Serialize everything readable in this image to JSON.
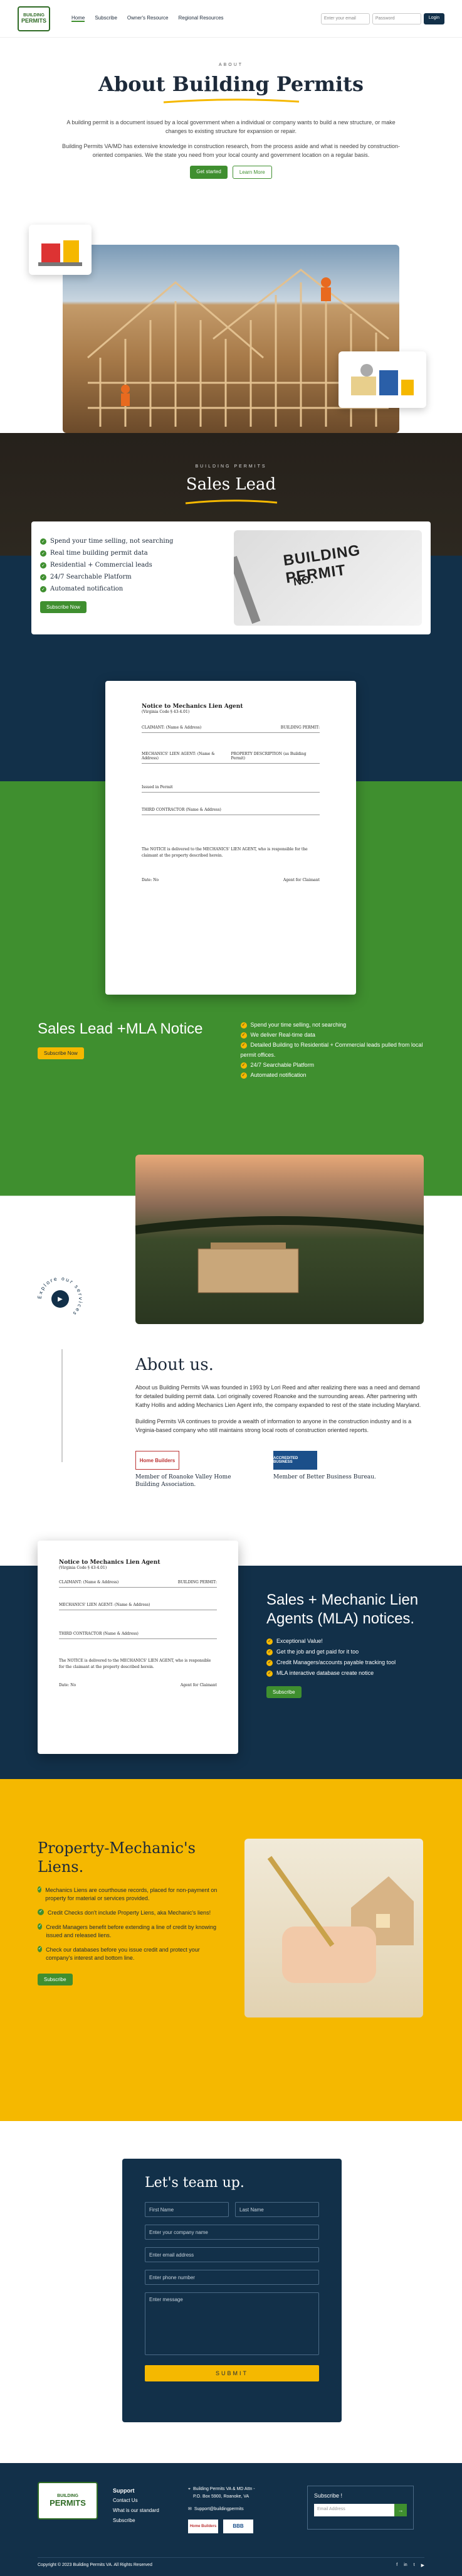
{
  "header": {
    "logo_line1": "BUILDING",
    "logo_line2": "PERMITS",
    "nav": [
      "Home",
      "Subscribe",
      "Owner's Resource",
      "Regional Resources"
    ],
    "search_placeholder": "Enter your email",
    "search_field2": "Password",
    "login_label": "Login"
  },
  "about_permits": {
    "eyebrow": "ABOUT",
    "title": "About Building Permits",
    "p1": "A building permit is a document issued by a local government when a individual or company wants to build a new structure, or make changes to existing structure for expansion or repair.",
    "p2": "Building Permits VA/MD has extensive knowledge in construction research, from the process aside and what is needed by construction-oriented companies. We the state you need from your local county and government location on a regular basis.",
    "btn1": "Get started",
    "btn2": "Learn More"
  },
  "sales_lead": {
    "eyebrow": "BUILDING PERMITS",
    "title": "Sales Lead",
    "items": [
      "Spend your time selling, not searching",
      "Real time building permit data",
      "Residential + Commercial leads",
      "24/7 Searchable Platform",
      "Automated notification"
    ],
    "btn": "Subscribe Now",
    "image_text": "BUILDING PERMIT",
    "image_no": "NO."
  },
  "document": {
    "title": "Notice to Mechanics Lien Agent",
    "subtitle": "(Virginia Code § 43-4.01)",
    "l1": "CLAIMANT: (Name & Address)",
    "l2": "BUILDING PERMIT:",
    "l3": "MECHANICS' LIEN AGENT: (Name & Address)",
    "l4": "PROPERTY DESCRIPTION (as Building Permit)",
    "l5": "Issued in Permit",
    "l6": "THIRD CONTRACTOR (Name & Address)",
    "l7": "The NOTICE is delivered to the MECHANICS' LIEN AGENT, who is responsible for the claimant at the property described herein.",
    "date": "Date: No",
    "sign": "Agent for Claimant"
  },
  "mla": {
    "title": "Sales Lead +MLA Notice",
    "btn": "Subscribe Now",
    "items": [
      "Spend your time selling, not searching",
      "We deliver Real-time data",
      "Detailed Building to Residential + Commercial leads pulled from local permit offices.",
      "24/7 Searchable Platform",
      "Automated notification"
    ]
  },
  "about_us": {
    "explore": "Explore our services",
    "title": "About us.",
    "p1": "About us Building Permits VA was founded in 1993 by Lori Reed and after realizing there was a need and demand for detailed building permit data. Lori originally covered Roanoke and the surrounding areas. After partnering with Kathy Hollis and adding Mechanics Lien Agent info, the company expanded to rest of the state including Maryland.",
    "p2": "Building Permits VA continues to provide a wealth of information to anyone in the construction industry and is a Virginia-based company who still maintains strong local roots of construction oriented reports.",
    "m1": "Member of Roanoke Valley Home Building Association.",
    "m2": "Member of Better Business Bureau.",
    "m1_logo": "Home Builders",
    "m2_logo": "ACCREDITED BUSINESS"
  },
  "sales_mechanic": {
    "title": "Sales + Mechanic Lien Agents (MLA) notices.",
    "items": [
      "Exceptional Value!",
      "Get the job and get paid for it too",
      "Credit Managers/accounts payable tracking tool",
      "MLA interactive database create notice"
    ],
    "btn": "Subscribe"
  },
  "property_liens": {
    "title": "Property-Mechanic's Liens.",
    "items": [
      "Mechanics Liens are courthouse records, placed for non-payment on property for material or services provided.",
      "Credit Checks don't include Property Liens, aka Mechanic's liens!",
      "Credit Managers benefit before extending a line of credit by knowing issued and released liens.",
      "Check our databases before you issue credit and protect your company's interest and bottom line."
    ],
    "btn": "Subscribe"
  },
  "team": {
    "title": "Let's team up.",
    "first": "First Name",
    "last": "Last Name",
    "company": "Enter your company name",
    "email": "Enter email address",
    "phone": "Enter phone number",
    "message": "Enter message",
    "submit": "SUBMIT"
  },
  "footer": {
    "support": "Support",
    "links": [
      "Contact Us",
      "What is our standard",
      "Subscribe"
    ],
    "address": "Building Permits VA & MD Attn - P.O. Box 5900, Roanoke, VA",
    "email": "Support@buildingpermits",
    "subscribe": "Subscribe !",
    "email_placeholder": "Email Address",
    "copyright": "Copyright © 2023 Building Permits VA. All Rights Reserved",
    "social": [
      "f",
      "in",
      "t",
      "▶"
    ],
    "logo1": "Home Builders",
    "logo2": "BBB"
  }
}
